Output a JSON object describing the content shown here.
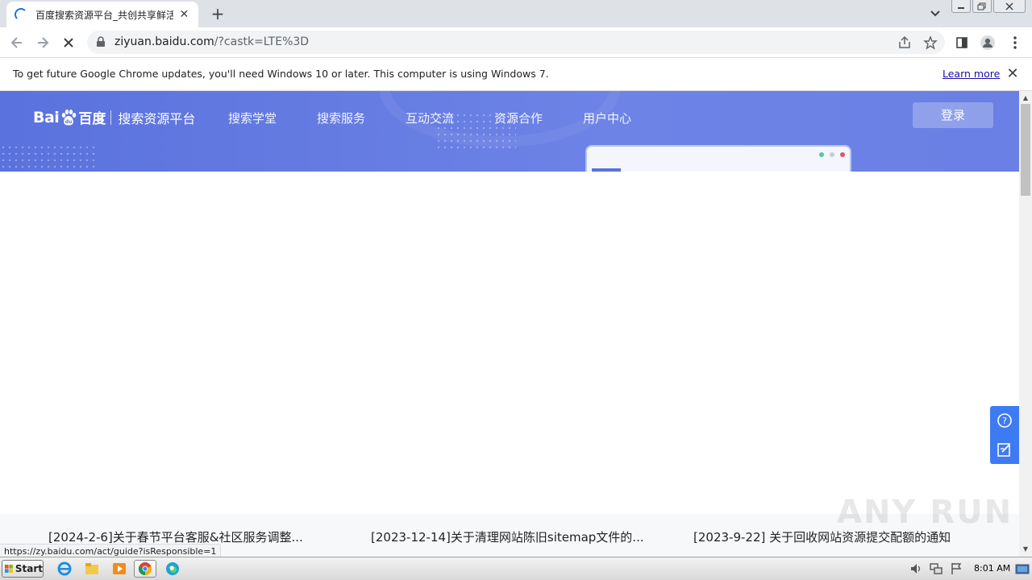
{
  "browser": {
    "tab": {
      "title": "百度搜索资源平台_共创共享鲜活搜",
      "close": "✕"
    },
    "new_tab": "+",
    "url": {
      "host": "ziyuan.baidu.com",
      "path": "/?castk=LTE%3D"
    },
    "infobar": {
      "message": "To get future Google Chrome updates, you'll need Windows 10 or later. This computer is using Windows 7.",
      "learn_more": "Learn more",
      "close": "✕"
    },
    "status_url": "https://zy.baidu.com/act/guide?isResponsible=1"
  },
  "page": {
    "logo": {
      "bai": "Bai",
      "du": "百度",
      "platform": "搜索资源平台"
    },
    "nav": [
      "搜索学堂",
      "搜索服务",
      "互动交流",
      "资源合作",
      "用户中心"
    ],
    "login": "登录",
    "news": [
      "[2024-2-6]关于春节平台客服&社区服务调整...",
      "[2023-12-14]关于清理网站陈旧sitemap文件的...",
      "[2023-9-22] 关于回收网站资源提交配额的通知"
    ],
    "watermark": "ANY RUN"
  },
  "taskbar": {
    "start": "Start",
    "clock": "8:01 AM"
  },
  "colors": {
    "brand": "#5a72dd",
    "float_panel": "#3e7bf3"
  }
}
